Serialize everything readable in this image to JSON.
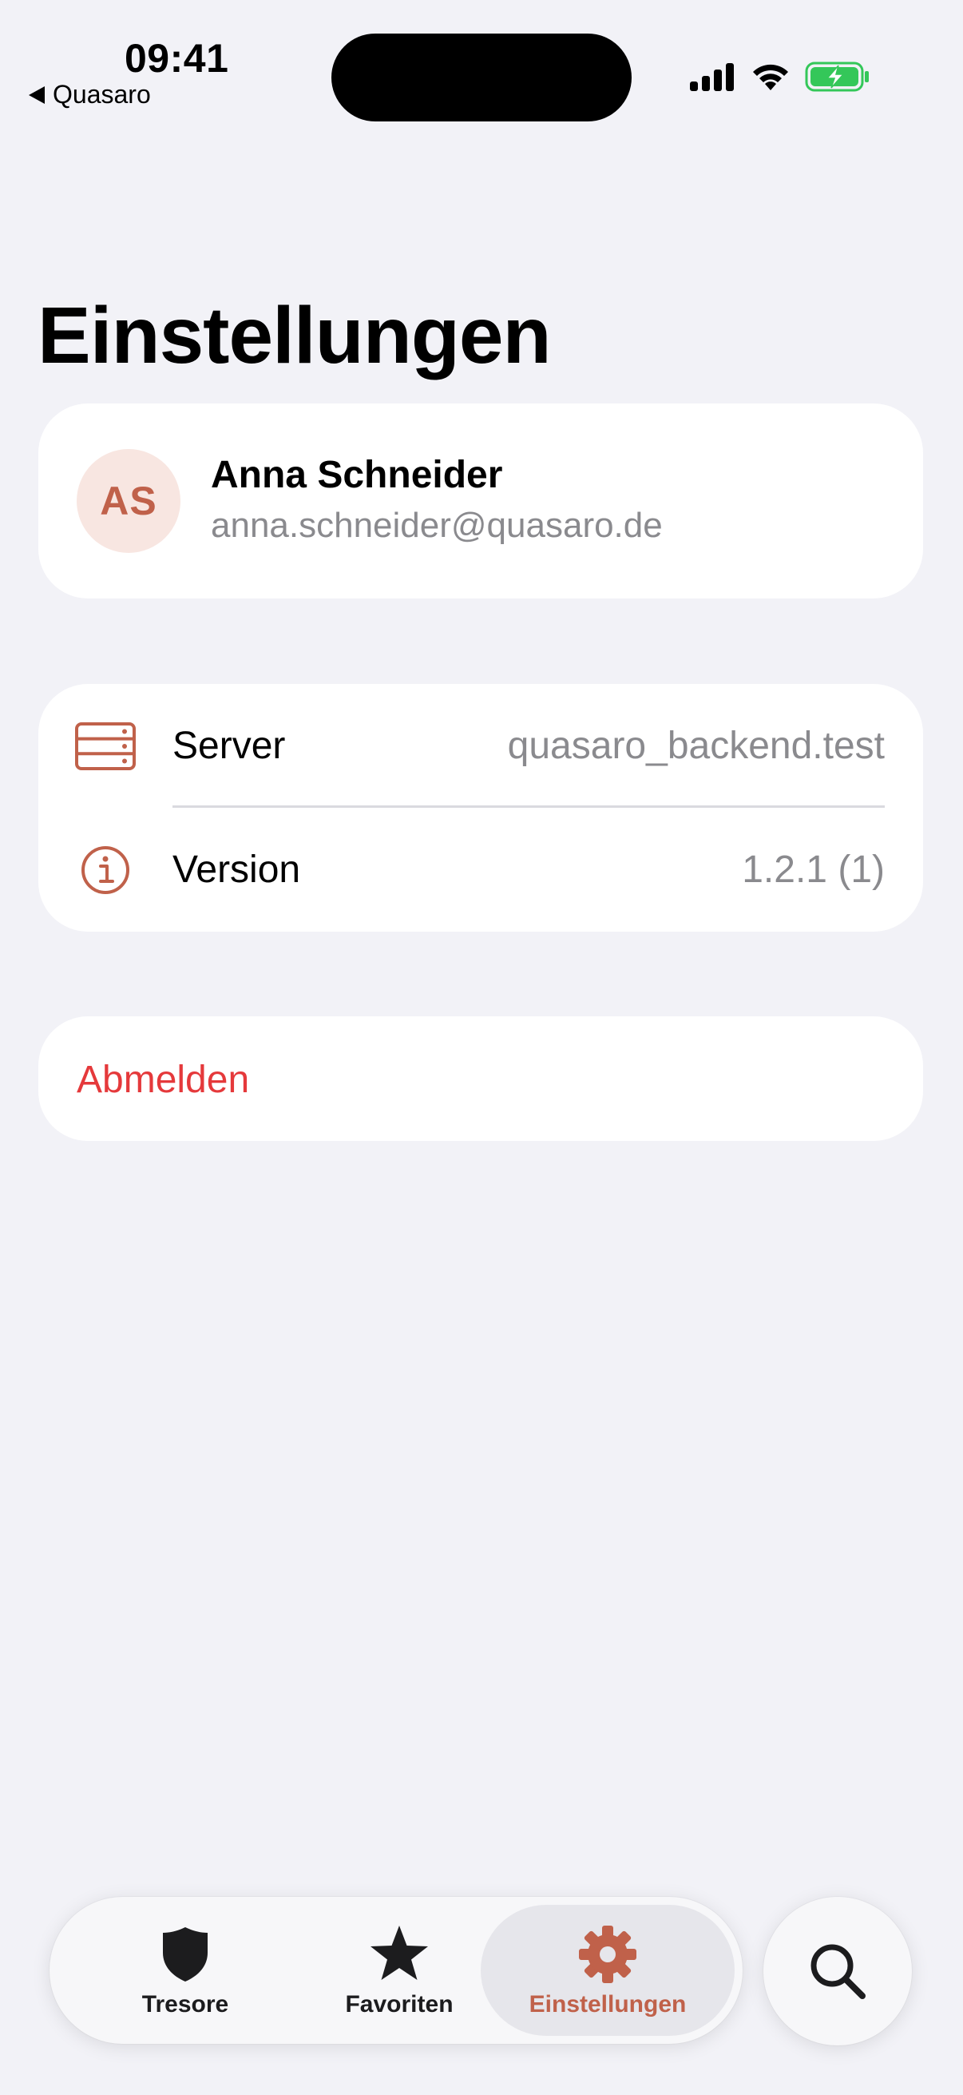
{
  "status_bar": {
    "time": "09:41",
    "back_label": "Quasaro",
    "battery_color": "#34C759"
  },
  "page": {
    "title": "Einstellungen"
  },
  "profile": {
    "initials": "AS",
    "name": "Anna Schneider",
    "email": "anna.schneider@quasaro.de"
  },
  "info_rows": [
    {
      "label": "Server",
      "value": "quasaro_backend.test",
      "icon": "server-icon"
    },
    {
      "label": "Version",
      "value": "1.2.1 (1)",
      "icon": "info-icon"
    }
  ],
  "logout": {
    "label": "Abmelden",
    "color": "#E5393B"
  },
  "tabbar": {
    "tabs": [
      {
        "label": "Tresore",
        "icon": "shield-icon",
        "selected": false
      },
      {
        "label": "Favoriten",
        "icon": "star-icon",
        "selected": false
      },
      {
        "label": "Einstellungen",
        "icon": "gear-icon",
        "selected": true
      }
    ],
    "search_icon": "search-icon"
  },
  "colors": {
    "accent": "#C0614A",
    "background": "#F2F2F7",
    "secondary_text": "#8A8A8E"
  }
}
